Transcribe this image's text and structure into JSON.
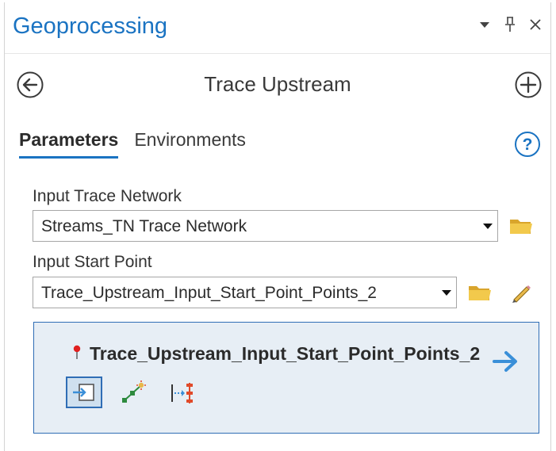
{
  "pane": {
    "title": "Geoprocessing",
    "controls": [
      "menu-dropdown-icon",
      "pin-icon",
      "close-icon"
    ]
  },
  "tool": {
    "title": "Trace Upstream"
  },
  "tabs": [
    {
      "label": "Parameters",
      "active": true
    },
    {
      "label": "Environments",
      "active": false
    }
  ],
  "params": {
    "trace_network": {
      "label": "Input Trace Network",
      "value": "Streams_TN Trace Network"
    },
    "start_point": {
      "label": "Input Start Point",
      "value": "Trace_Upstream_Input_Start_Point_Points_2"
    }
  },
  "feature": {
    "layer_name": "Trace_Upstream_Input_Start_Point_Points_2",
    "tools": [
      "select-features-icon",
      "add-point-sketch-icon",
      "barrier-icon"
    ]
  },
  "colors": {
    "accent": "#1a73c2",
    "folder": "#e2b33a",
    "feature_bg": "#e7eef5",
    "pin": "#e02020"
  }
}
